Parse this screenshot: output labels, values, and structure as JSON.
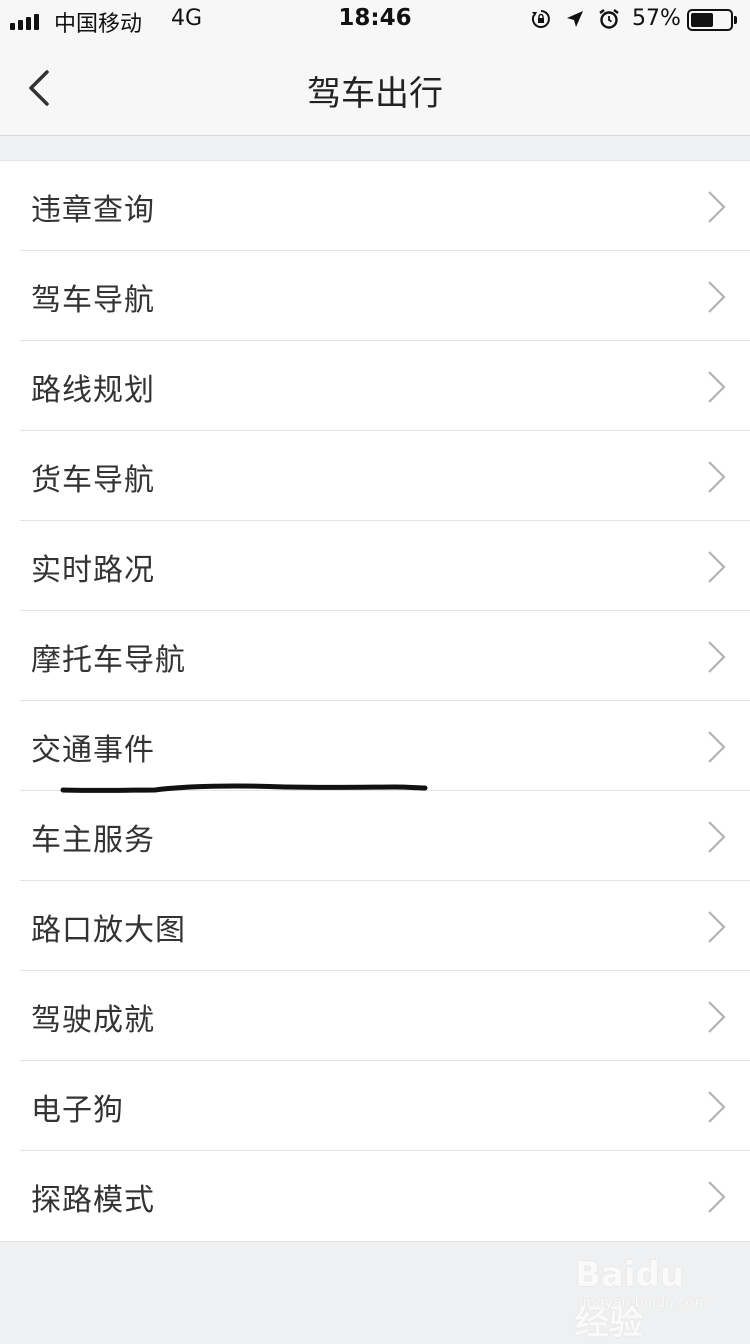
{
  "status_bar": {
    "carrier": "中国移动",
    "network": "4G",
    "time": "18:46",
    "battery_percent": "57%",
    "battery_level": 0.57,
    "icons": [
      "signal-icon",
      "orientation-lock-icon",
      "location-icon",
      "alarm-icon",
      "battery-icon"
    ]
  },
  "nav": {
    "title": "驾车出行",
    "back_icon": "chevron-left-icon"
  },
  "menu": {
    "items": [
      {
        "label": "违章查询"
      },
      {
        "label": "驾车导航"
      },
      {
        "label": "路线规划"
      },
      {
        "label": "货车导航"
      },
      {
        "label": "实时路况"
      },
      {
        "label": "摩托车导航"
      },
      {
        "label": "交通事件"
      },
      {
        "label": "车主服务"
      },
      {
        "label": "路口放大图"
      },
      {
        "label": "驾驶成就"
      },
      {
        "label": "电子狗"
      },
      {
        "label": "探路模式"
      }
    ],
    "item_icon": "chevron-right-icon"
  },
  "watermark": {
    "brand": "Baidu经验",
    "sub": "jingyan.baidu.com"
  }
}
